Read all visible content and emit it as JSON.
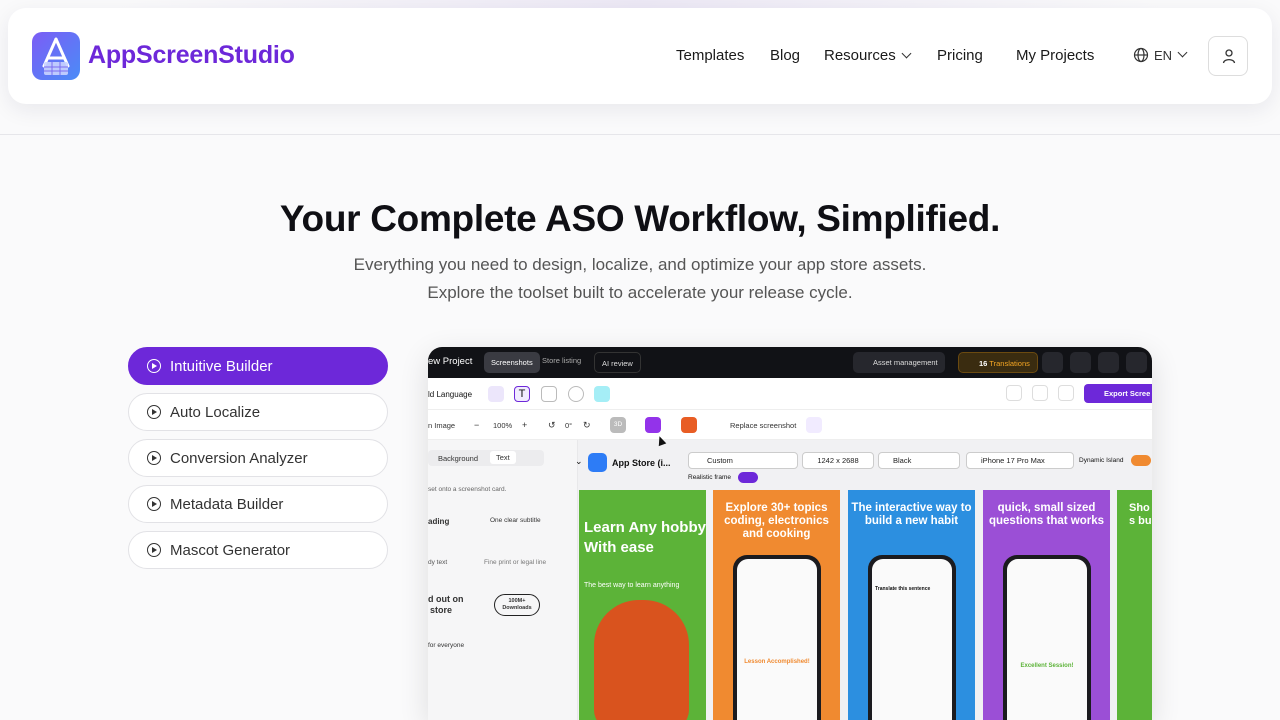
{
  "brand": {
    "name": "AppScreenStudio"
  },
  "nav": {
    "templates": "Templates",
    "blog": "Blog",
    "resources": "Resources",
    "pricing": "Pricing",
    "projects": "My Projects",
    "language": "EN"
  },
  "hero": {
    "title": "Your Complete ASO Workflow, Simplified.",
    "subtitle_line1": "Everything you need to design, localize, and optimize your app store assets.",
    "subtitle_line2": "Explore the toolset built to accelerate your release cycle."
  },
  "features": [
    {
      "label": "Intuitive Builder",
      "active": true
    },
    {
      "label": "Auto Localize",
      "active": false
    },
    {
      "label": "Conversion Analyzer",
      "active": false
    },
    {
      "label": "Metadata Builder",
      "active": false
    },
    {
      "label": "Mascot Generator",
      "active": false
    }
  ],
  "preview": {
    "project_title": "ew Project",
    "tab_screenshots": "Screenshots",
    "tab_store_listing": "Store listing",
    "tab_ai_review": "AI review",
    "asset_management": "Asset management",
    "translations_count": "16",
    "translations_label": "Translations",
    "add_language": "ld Language",
    "export": "Export Scree",
    "image_label": "n Image",
    "zoom": "100%",
    "rotation": "0°",
    "badge_3d": "3D",
    "replace_screenshot": "Replace screenshot",
    "side_tab_background": "Background",
    "side_tab_text": "Text",
    "side_hint": "set onto a screenshot card.",
    "side_heading": "ading",
    "side_subtitle": "One clear subtitle",
    "side_body": "dy text",
    "side_fine": "Fine print or legal line",
    "side_standout": "d out on",
    "side_standout2": "store",
    "side_badge1": "100M+",
    "side_badge2": "Downloads",
    "side_for_everyone": "for everyone",
    "store_label": "App Store (i...",
    "size_preset": "Custom",
    "width": "1242",
    "x": "x",
    "height": "2688",
    "color": "Black",
    "device": "iPhone 17 Pro Max",
    "dynamic_island": "Dynamic Island",
    "realistic_frame": "Realistic frame",
    "cards": [
      {
        "caption": "Learn Any hobby With ease",
        "sub": "The best way to learn anything",
        "bg": "#5cb338"
      },
      {
        "caption": "Explore 30+ topics coding, electronics and cooking",
        "sub": "Lesson Accomplished!",
        "bg": "#f08a30"
      },
      {
        "caption": "The interactive way to build a new habit",
        "sub": "Translate this sentence",
        "bg": "#2c8fe0"
      },
      {
        "caption": "quick, small sized questions that works",
        "sub": "Excellent Session!",
        "bg": "#9b4fd6"
      },
      {
        "caption": "Sho s bu",
        "sub": "",
        "bg": "#5cb338"
      }
    ]
  }
}
